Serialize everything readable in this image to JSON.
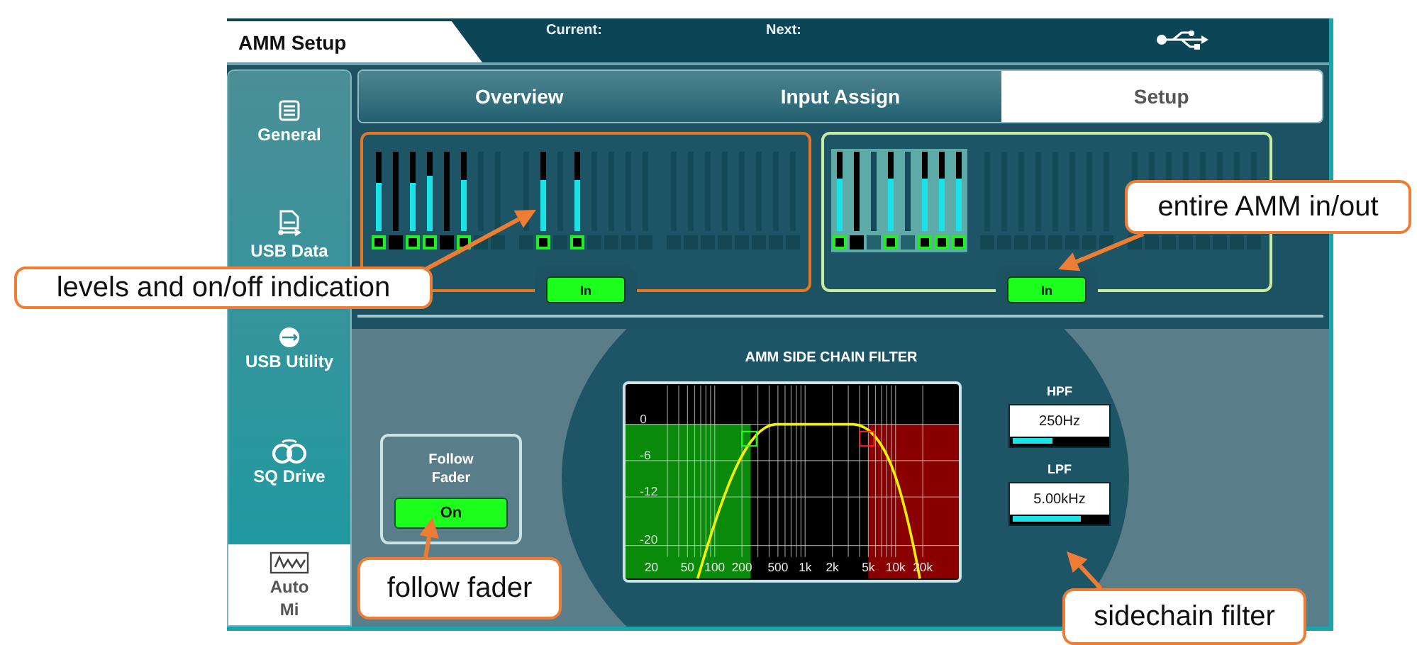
{
  "header": {
    "title": "AMM Setup",
    "current_label": "Current:",
    "next_label": "Next:"
  },
  "sidebar": {
    "items": [
      {
        "label_lines": [
          "General"
        ],
        "selected": false
      },
      {
        "label_lines": [
          "USB Data"
        ],
        "selected": false
      },
      {
        "label_lines": [
          "USB Utility"
        ],
        "selected": false
      },
      {
        "label_lines": [
          "SQ Drive"
        ],
        "selected": false
      },
      {
        "label_lines": [
          "Auto",
          "Mi"
        ],
        "selected": true
      }
    ]
  },
  "tabs": [
    {
      "label": "Overview",
      "selected": false
    },
    {
      "label": "Input Assign",
      "selected": false
    },
    {
      "label": "Setup",
      "selected": true
    }
  ],
  "meters": [
    {
      "color": "#e87722",
      "in_button": {
        "label": "In",
        "on": true
      },
      "channels": [
        {
          "kind": "on",
          "level": 0.6,
          "selected": false
        },
        {
          "kind": "off",
          "selected": false
        },
        {
          "kind": "on",
          "level": 0.6,
          "selected": false
        },
        {
          "kind": "on",
          "level": 0.7,
          "selected": false
        },
        {
          "kind": "off",
          "selected": false
        },
        {
          "kind": "on",
          "level": 0.65,
          "selected": false
        },
        {
          "kind": "unused",
          "selected": false
        },
        {
          "kind": "unused",
          "selected": false
        },
        {
          "kind": "unused",
          "selected": false
        },
        {
          "kind": "on",
          "level": 0.65,
          "selected": false
        },
        {
          "kind": "unused",
          "selected": false
        },
        {
          "kind": "on",
          "level": 0.65,
          "selected": false
        },
        {
          "kind": "unused",
          "selected": false
        },
        {
          "kind": "unused",
          "selected": false
        },
        {
          "kind": "unused",
          "selected": false
        },
        {
          "kind": "unused",
          "selected": false
        },
        {
          "kind": "unused",
          "selected": false
        },
        {
          "kind": "unused",
          "selected": false
        },
        {
          "kind": "unused",
          "selected": false
        },
        {
          "kind": "unused",
          "selected": false
        },
        {
          "kind": "unused",
          "selected": false
        },
        {
          "kind": "unused",
          "selected": false
        },
        {
          "kind": "unused",
          "selected": false
        },
        {
          "kind": "unused",
          "selected": false
        }
      ]
    },
    {
      "color": "#c8eca0",
      "in_button": {
        "label": "In",
        "on": true
      },
      "channels": [
        {
          "kind": "on",
          "level": 0.66,
          "selected": true
        },
        {
          "kind": "off",
          "selected": true
        },
        {
          "kind": "unused",
          "selected": true
        },
        {
          "kind": "on",
          "level": 0.66,
          "selected": true
        },
        {
          "kind": "unused",
          "selected": true
        },
        {
          "kind": "on",
          "level": 0.66,
          "selected": true
        },
        {
          "kind": "on",
          "level": 0.66,
          "selected": true
        },
        {
          "kind": "on",
          "level": 0.66,
          "selected": true
        },
        {
          "kind": "unused",
          "selected": false
        },
        {
          "kind": "unused",
          "selected": false
        },
        {
          "kind": "unused",
          "selected": false
        },
        {
          "kind": "unused",
          "selected": false
        },
        {
          "kind": "unused",
          "selected": false
        },
        {
          "kind": "unused",
          "selected": false
        },
        {
          "kind": "unused",
          "selected": false
        },
        {
          "kind": "unused",
          "selected": false
        },
        {
          "kind": "unused",
          "selected": false
        },
        {
          "kind": "unused",
          "selected": false
        },
        {
          "kind": "unused",
          "selected": false
        },
        {
          "kind": "unused",
          "selected": false
        },
        {
          "kind": "unused",
          "selected": false
        },
        {
          "kind": "unused",
          "selected": false
        },
        {
          "kind": "unused",
          "selected": false
        },
        {
          "kind": "unused",
          "selected": false
        }
      ]
    }
  ],
  "follow_fader": {
    "title": "Follow Fader",
    "button": {
      "label": "On",
      "on": true
    }
  },
  "side_chain_filter": {
    "title": "AMM SIDE CHAIN FILTER",
    "y_labels": [
      "0",
      "-6",
      "-12",
      "-20"
    ],
    "x_labels": [
      "20",
      "50",
      "100",
      "200",
      "500",
      "1k",
      "2k",
      "5k",
      "10k",
      "20k"
    ],
    "filters": [
      {
        "label": "HPF",
        "value": "250Hz",
        "level": 0.42
      },
      {
        "label": "LPF",
        "value": "5.00kHz",
        "level": 0.72
      }
    ]
  },
  "callouts": [
    {
      "text": "levels and on/off indication"
    },
    {
      "text": "entire AMM in/out"
    },
    {
      "text": "follow fader"
    },
    {
      "text": "sidechain filter"
    }
  ]
}
